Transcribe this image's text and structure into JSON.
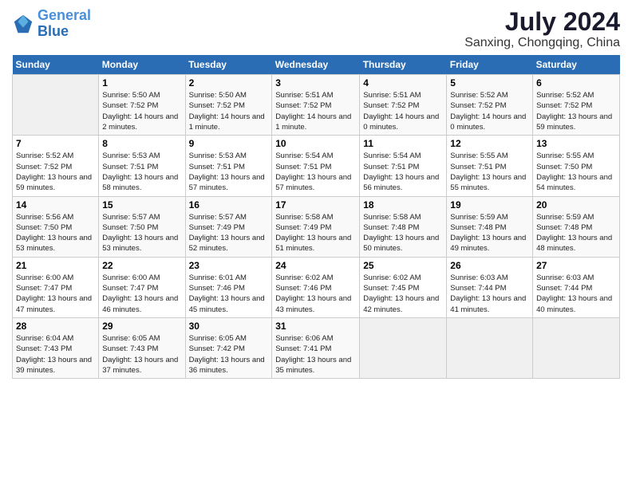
{
  "logo": {
    "line1": "General",
    "line2": "Blue"
  },
  "title": "July 2024",
  "subtitle": "Sanxing, Chongqing, China",
  "days_header": [
    "Sunday",
    "Monday",
    "Tuesday",
    "Wednesday",
    "Thursday",
    "Friday",
    "Saturday"
  ],
  "weeks": [
    [
      {
        "num": "",
        "sunrise": "",
        "sunset": "",
        "daylight": ""
      },
      {
        "num": "1",
        "sunrise": "Sunrise: 5:50 AM",
        "sunset": "Sunset: 7:52 PM",
        "daylight": "Daylight: 14 hours and 2 minutes."
      },
      {
        "num": "2",
        "sunrise": "Sunrise: 5:50 AM",
        "sunset": "Sunset: 7:52 PM",
        "daylight": "Daylight: 14 hours and 1 minute."
      },
      {
        "num": "3",
        "sunrise": "Sunrise: 5:51 AM",
        "sunset": "Sunset: 7:52 PM",
        "daylight": "Daylight: 14 hours and 1 minute."
      },
      {
        "num": "4",
        "sunrise": "Sunrise: 5:51 AM",
        "sunset": "Sunset: 7:52 PM",
        "daylight": "Daylight: 14 hours and 0 minutes."
      },
      {
        "num": "5",
        "sunrise": "Sunrise: 5:52 AM",
        "sunset": "Sunset: 7:52 PM",
        "daylight": "Daylight: 14 hours and 0 minutes."
      },
      {
        "num": "6",
        "sunrise": "Sunrise: 5:52 AM",
        "sunset": "Sunset: 7:52 PM",
        "daylight": "Daylight: 13 hours and 59 minutes."
      }
    ],
    [
      {
        "num": "7",
        "sunrise": "Sunrise: 5:52 AM",
        "sunset": "Sunset: 7:52 PM",
        "daylight": "Daylight: 13 hours and 59 minutes."
      },
      {
        "num": "8",
        "sunrise": "Sunrise: 5:53 AM",
        "sunset": "Sunset: 7:51 PM",
        "daylight": "Daylight: 13 hours and 58 minutes."
      },
      {
        "num": "9",
        "sunrise": "Sunrise: 5:53 AM",
        "sunset": "Sunset: 7:51 PM",
        "daylight": "Daylight: 13 hours and 57 minutes."
      },
      {
        "num": "10",
        "sunrise": "Sunrise: 5:54 AM",
        "sunset": "Sunset: 7:51 PM",
        "daylight": "Daylight: 13 hours and 57 minutes."
      },
      {
        "num": "11",
        "sunrise": "Sunrise: 5:54 AM",
        "sunset": "Sunset: 7:51 PM",
        "daylight": "Daylight: 13 hours and 56 minutes."
      },
      {
        "num": "12",
        "sunrise": "Sunrise: 5:55 AM",
        "sunset": "Sunset: 7:51 PM",
        "daylight": "Daylight: 13 hours and 55 minutes."
      },
      {
        "num": "13",
        "sunrise": "Sunrise: 5:55 AM",
        "sunset": "Sunset: 7:50 PM",
        "daylight": "Daylight: 13 hours and 54 minutes."
      }
    ],
    [
      {
        "num": "14",
        "sunrise": "Sunrise: 5:56 AM",
        "sunset": "Sunset: 7:50 PM",
        "daylight": "Daylight: 13 hours and 53 minutes."
      },
      {
        "num": "15",
        "sunrise": "Sunrise: 5:57 AM",
        "sunset": "Sunset: 7:50 PM",
        "daylight": "Daylight: 13 hours and 53 minutes."
      },
      {
        "num": "16",
        "sunrise": "Sunrise: 5:57 AM",
        "sunset": "Sunset: 7:49 PM",
        "daylight": "Daylight: 13 hours and 52 minutes."
      },
      {
        "num": "17",
        "sunrise": "Sunrise: 5:58 AM",
        "sunset": "Sunset: 7:49 PM",
        "daylight": "Daylight: 13 hours and 51 minutes."
      },
      {
        "num": "18",
        "sunrise": "Sunrise: 5:58 AM",
        "sunset": "Sunset: 7:48 PM",
        "daylight": "Daylight: 13 hours and 50 minutes."
      },
      {
        "num": "19",
        "sunrise": "Sunrise: 5:59 AM",
        "sunset": "Sunset: 7:48 PM",
        "daylight": "Daylight: 13 hours and 49 minutes."
      },
      {
        "num": "20",
        "sunrise": "Sunrise: 5:59 AM",
        "sunset": "Sunset: 7:48 PM",
        "daylight": "Daylight: 13 hours and 48 minutes."
      }
    ],
    [
      {
        "num": "21",
        "sunrise": "Sunrise: 6:00 AM",
        "sunset": "Sunset: 7:47 PM",
        "daylight": "Daylight: 13 hours and 47 minutes."
      },
      {
        "num": "22",
        "sunrise": "Sunrise: 6:00 AM",
        "sunset": "Sunset: 7:47 PM",
        "daylight": "Daylight: 13 hours and 46 minutes."
      },
      {
        "num": "23",
        "sunrise": "Sunrise: 6:01 AM",
        "sunset": "Sunset: 7:46 PM",
        "daylight": "Daylight: 13 hours and 45 minutes."
      },
      {
        "num": "24",
        "sunrise": "Sunrise: 6:02 AM",
        "sunset": "Sunset: 7:46 PM",
        "daylight": "Daylight: 13 hours and 43 minutes."
      },
      {
        "num": "25",
        "sunrise": "Sunrise: 6:02 AM",
        "sunset": "Sunset: 7:45 PM",
        "daylight": "Daylight: 13 hours and 42 minutes."
      },
      {
        "num": "26",
        "sunrise": "Sunrise: 6:03 AM",
        "sunset": "Sunset: 7:44 PM",
        "daylight": "Daylight: 13 hours and 41 minutes."
      },
      {
        "num": "27",
        "sunrise": "Sunrise: 6:03 AM",
        "sunset": "Sunset: 7:44 PM",
        "daylight": "Daylight: 13 hours and 40 minutes."
      }
    ],
    [
      {
        "num": "28",
        "sunrise": "Sunrise: 6:04 AM",
        "sunset": "Sunset: 7:43 PM",
        "daylight": "Daylight: 13 hours and 39 minutes."
      },
      {
        "num": "29",
        "sunrise": "Sunrise: 6:05 AM",
        "sunset": "Sunset: 7:43 PM",
        "daylight": "Daylight: 13 hours and 37 minutes."
      },
      {
        "num": "30",
        "sunrise": "Sunrise: 6:05 AM",
        "sunset": "Sunset: 7:42 PM",
        "daylight": "Daylight: 13 hours and 36 minutes."
      },
      {
        "num": "31",
        "sunrise": "Sunrise: 6:06 AM",
        "sunset": "Sunset: 7:41 PM",
        "daylight": "Daylight: 13 hours and 35 minutes."
      },
      {
        "num": "",
        "sunrise": "",
        "sunset": "",
        "daylight": ""
      },
      {
        "num": "",
        "sunrise": "",
        "sunset": "",
        "daylight": ""
      },
      {
        "num": "",
        "sunrise": "",
        "sunset": "",
        "daylight": ""
      }
    ]
  ]
}
